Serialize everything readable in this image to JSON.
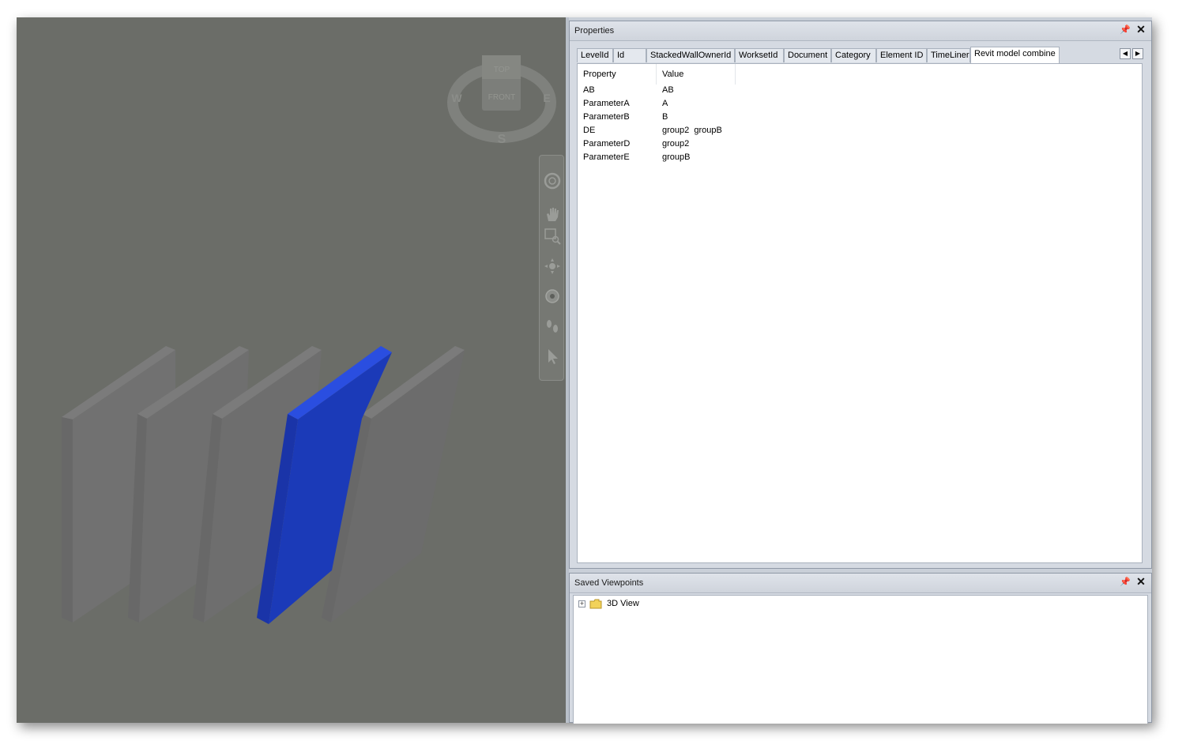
{
  "viewcube": {
    "top_label": "TOP",
    "front_label": "FRONT",
    "west_label": "W",
    "east_label": "E",
    "south_label": "S"
  },
  "properties_panel": {
    "title": "Properties",
    "tabs": [
      {
        "label": "LevelId"
      },
      {
        "label": "Id"
      },
      {
        "label": "StackedWallOwnerId"
      },
      {
        "label": "WorksetId"
      },
      {
        "label": "Document"
      },
      {
        "label": "Category"
      },
      {
        "label": "Element ID"
      },
      {
        "label": "TimeLiner"
      },
      {
        "label": "Revit model combine"
      }
    ],
    "active_tab": "Revit model combine",
    "columns": {
      "property": "Property",
      "value": "Value"
    },
    "rows": [
      {
        "property": "AB",
        "value": "AB"
      },
      {
        "property": "ParameterA",
        "value": "A"
      },
      {
        "property": "ParameterB",
        "value": "B"
      },
      {
        "property": "DE",
        "value": "group2  groupB"
      },
      {
        "property": "ParameterD",
        "value": "group2"
      },
      {
        "property": "ParameterE",
        "value": "groupB"
      }
    ]
  },
  "saved_viewpoints_panel": {
    "title": "Saved Viewpoints",
    "items": [
      {
        "label": "3D View",
        "expander": "+"
      }
    ]
  },
  "colors": {
    "viewport_bg": "#6b6d68",
    "selected_wall": "#1a3bb8",
    "wall": "#717171"
  }
}
